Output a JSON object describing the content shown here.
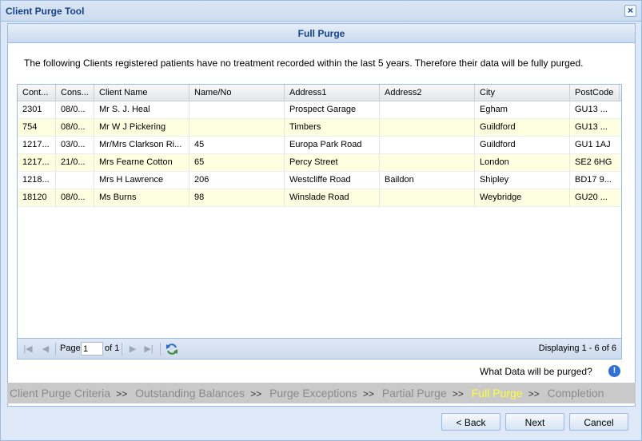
{
  "window": {
    "title": "Client Purge Tool",
    "close_glyph": "×"
  },
  "panel": {
    "header": "Full Purge"
  },
  "intro_text": "The following Clients registered patients have no treatment recorded within the last 5 years. Therefore their data will be fully purged.",
  "grid": {
    "columns": [
      "Cont...",
      "Cons...",
      "Client Name",
      "Name/No",
      "Address1",
      "Address2",
      "City",
      "PostCode"
    ],
    "rows": [
      [
        "2301",
        "08/0...",
        "Mr S. J. Heal",
        "",
        "Prospect Garage",
        "",
        "Egham",
        "GU13 ..."
      ],
      [
        "754",
        "08/0...",
        "Mr W J Pickering",
        "",
        "Timbers",
        "",
        "Guildford",
        "GU13 ..."
      ],
      [
        "1217...",
        "03/0...",
        "Mr/Mrs Clarkson Ri...",
        "45",
        "Europa Park Road",
        "",
        "Guildford",
        "GU1 1AJ"
      ],
      [
        "1217...",
        "21/0...",
        "Mrs Fearne Cotton",
        "65",
        "Percy Street",
        "",
        "London",
        "SE2 6HG"
      ],
      [
        "1218...",
        "",
        "Mrs H Lawrence",
        "206",
        "Westcliffe Road",
        "Baildon",
        "Shipley",
        "BD17 9..."
      ],
      [
        "18120",
        "08/0...",
        "Ms Burns",
        "98",
        "Winslade Road",
        "",
        "Weybridge",
        "GU20 ..."
      ]
    ]
  },
  "paging": {
    "page_label": "Page",
    "page_value": "1",
    "of_label": "of 1",
    "display_info": "Displaying 1 - 6 of 6"
  },
  "what_data_label": "What Data will be purged?",
  "steps": {
    "items": [
      "Client Purge Criteria",
      "Outstanding Balances",
      "Purge Exceptions",
      "Partial Purge",
      "Full Purge",
      "Completion"
    ],
    "separator": ">>",
    "active_index": 4
  },
  "buttons": {
    "back": "< Back",
    "next": "Next",
    "cancel": "Cancel"
  },
  "colors": {
    "accent": "#15428b",
    "active_step": "#ffff33",
    "row_alt": "#fefee0"
  }
}
